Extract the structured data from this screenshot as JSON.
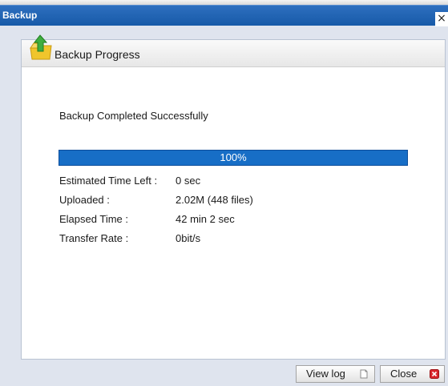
{
  "window": {
    "title": "Backup",
    "close_glyph": "×"
  },
  "header": {
    "title": "Backup Progress",
    "icon": "folder-upload-icon"
  },
  "status": {
    "message": "Backup Completed Successfully"
  },
  "progress": {
    "label": "100%",
    "percent": 100
  },
  "details": [
    {
      "label": "Estimated Time Left :",
      "value": "0 sec"
    },
    {
      "label": "Uploaded :",
      "value": "2.02M (448 files)"
    },
    {
      "label": "Elapsed Time :",
      "value": "42 min 2 sec"
    },
    {
      "label": "Transfer Rate :",
      "value": "0bit/s"
    }
  ],
  "buttons": {
    "view_log": {
      "label": "View log",
      "icon": "document-icon"
    },
    "close": {
      "label": "Close",
      "icon": "red-close-icon"
    }
  },
  "colors": {
    "titlebar": "#1b5fad",
    "progress_fill": "#176ec6",
    "close_icon": "#d9262c"
  }
}
